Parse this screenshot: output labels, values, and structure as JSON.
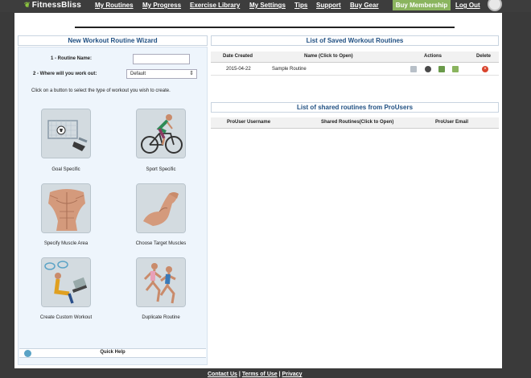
{
  "nav": {
    "logo": "FitnessBliss",
    "links": [
      "My Routines",
      "My Progress",
      "Exercise Library",
      "My Settings",
      "Tips",
      "Support",
      "Buy Gear"
    ],
    "membership_button": "Buy Membership",
    "logout": "Log Out"
  },
  "wizard": {
    "title": "New Workout Routine Wizard",
    "routine_name_label": "1 - Routine Name:",
    "routine_name_value": "",
    "location_label": "2 - Where will you work out:",
    "location_selected": "Default",
    "instructions": "Click on a button to select the type of workout you wish to create.",
    "options": [
      {
        "label": "Goal Specific",
        "icon": "soccer-goal-icon"
      },
      {
        "label": "Sport Specific",
        "icon": "cyclist-icon"
      },
      {
        "label": "Specify Muscle Area",
        "icon": "torso-muscles-icon"
      },
      {
        "label": "Choose Target Muscles",
        "icon": "flexed-arm-icon"
      },
      {
        "label": "Create Custom Workout",
        "icon": "custom-workout-icon"
      },
      {
        "label": "Duplicate Routine",
        "icon": "runners-icon"
      }
    ],
    "quick_help": "Quick Help"
  },
  "saved": {
    "title": "List of Saved Workout Routines",
    "columns": [
      "Date Created",
      "Name (Click to Open)",
      "Actions",
      "Delete"
    ],
    "rows": [
      {
        "date": "2015-04-22",
        "name": "Sample Routine"
      }
    ]
  },
  "shared": {
    "title": "List of shared routines from ProUsers",
    "columns": [
      "ProUser Username",
      "Shared Routines(Click to Open)",
      "ProUser Email"
    ]
  },
  "footer": {
    "links": [
      "Contact Us",
      "Terms of Use",
      "Privacy"
    ],
    "separator": "|"
  }
}
